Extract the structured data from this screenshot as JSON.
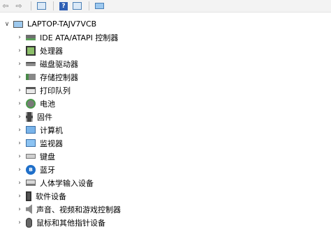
{
  "toolbar": {
    "buttons": [
      {
        "name": "back-button",
        "glyph": "⇦"
      },
      {
        "name": "forward-button",
        "glyph": "⇨"
      },
      {
        "name": "properties-button",
        "icon": "window-icon"
      },
      {
        "name": "help-button",
        "glyph": "?"
      },
      {
        "name": "show-hidden-button",
        "icon": "window-icon"
      },
      {
        "name": "scan-hardware-button",
        "icon": "monitor-icon"
      }
    ]
  },
  "tree": {
    "root": {
      "label": "LAPTOP-TAJV7VCB",
      "expanded": true,
      "icon": "laptop-icon"
    },
    "items": [
      {
        "label": "IDE ATA/ATAPI 控制器",
        "icon": "ide-controller-icon"
      },
      {
        "label": "处理器",
        "icon": "processor-icon"
      },
      {
        "label": "磁盘驱动器",
        "icon": "disk-drive-icon"
      },
      {
        "label": "存储控制器",
        "icon": "storage-controller-icon"
      },
      {
        "label": "打印队列",
        "icon": "printer-icon"
      },
      {
        "label": "电池",
        "icon": "battery-icon"
      },
      {
        "label": "固件",
        "icon": "firmware-icon"
      },
      {
        "label": "计算机",
        "icon": "computer-icon"
      },
      {
        "label": "监视器",
        "icon": "monitor-icon"
      },
      {
        "label": "键盘",
        "icon": "keyboard-icon"
      },
      {
        "label": "蓝牙",
        "icon": "bluetooth-icon"
      },
      {
        "label": "人体学输入设备",
        "icon": "hid-icon"
      },
      {
        "label": "软件设备",
        "icon": "software-device-icon"
      },
      {
        "label": "声音、视频和游戏控制器",
        "icon": "sound-icon"
      },
      {
        "label": "鼠标和其他指针设备",
        "icon": "mouse-icon"
      }
    ]
  },
  "glyphs": {
    "expanded": "∨",
    "collapsed": "›",
    "bluetooth": "ʙ"
  }
}
